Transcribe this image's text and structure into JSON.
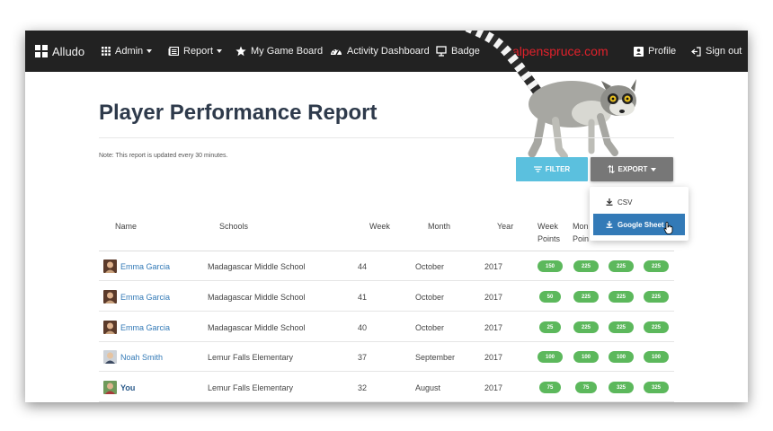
{
  "navbar": {
    "brand": "Alludo",
    "items": [
      {
        "label": "Admin",
        "icon": "grid-icon",
        "has_caret": true
      },
      {
        "label": "Report",
        "icon": "report-icon",
        "has_caret": true
      },
      {
        "label": "My Game Board",
        "icon": "star-icon",
        "has_caret": false
      },
      {
        "label": "Activity Dashboard",
        "icon": "dashboard-icon",
        "has_caret": false
      },
      {
        "label": "Badge",
        "icon": "badge-icon",
        "has_caret": false
      }
    ],
    "watermark": "alpenspruce.com",
    "profile": "Profile",
    "signout": "Sign out"
  },
  "page": {
    "title": "Player Performance Report",
    "note": "Note: This report is updated every 30 minutes."
  },
  "toolbar": {
    "filter_label": "FILTER",
    "export_label": "EXPORT"
  },
  "export_menu": {
    "csv": "CSV",
    "google_sheet": "Google Sheet"
  },
  "table": {
    "headers": {
      "name": "Name",
      "schools": "Schools",
      "week": "Week",
      "month": "Month",
      "year": "Year",
      "week_points_1": "Week",
      "week_points_2": "Points",
      "month_points_1": "Mon",
      "month_points_2": "Poin"
    },
    "rows": [
      {
        "name": "Emma Garcia",
        "school": "Madagascar Middle School",
        "week": "44",
        "month": "October",
        "year": "2017",
        "badges": [
          "150",
          "225",
          "225",
          "225"
        ]
      },
      {
        "name": "Emma Garcia",
        "school": "Madagascar Middle School",
        "week": "41",
        "month": "October",
        "year": "2017",
        "badges": [
          "50",
          "225",
          "225",
          "225"
        ]
      },
      {
        "name": "Emma Garcia",
        "school": "Madagascar Middle School",
        "week": "40",
        "month": "October",
        "year": "2017",
        "badges": [
          "25",
          "225",
          "225",
          "225"
        ]
      },
      {
        "name": "Noah Smith",
        "school": "Lemur Falls Elementary",
        "week": "37",
        "month": "September",
        "year": "2017",
        "badges": [
          "100",
          "100",
          "100",
          "100"
        ]
      },
      {
        "name": "You",
        "school": "Lemur Falls Elementary",
        "week": "32",
        "month": "August",
        "year": "2017",
        "badges": [
          "75",
          "75",
          "325",
          "325"
        ]
      }
    ]
  },
  "colors": {
    "navbar": "#222222",
    "filter": "#5bc0de",
    "export": "#777777",
    "menu_active": "#337ab7",
    "badge": "#5cb85c",
    "link": "#337ab7",
    "watermark": "#e2212b"
  }
}
